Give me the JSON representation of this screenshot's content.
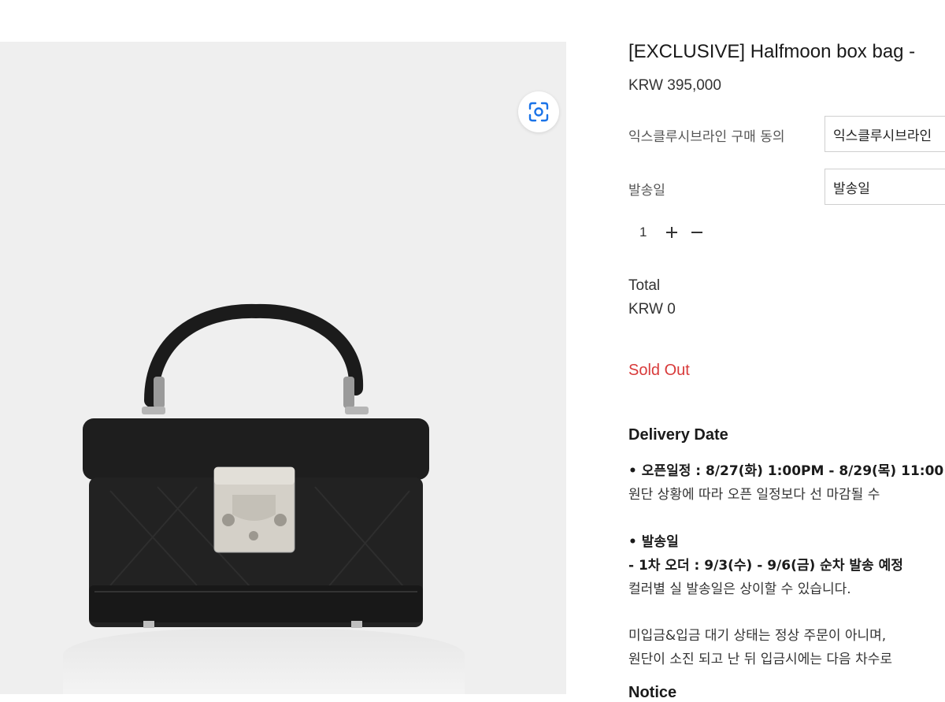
{
  "product": {
    "title": "[EXCLUSIVE] Halfmoon box bag - ",
    "price": "KRW 395,000"
  },
  "options": [
    {
      "label": "익스클루시브라인 구매 동의",
      "selected": "익스클루시브라인"
    },
    {
      "label": "발송일",
      "selected": "발송일"
    }
  ],
  "quantity": {
    "value": "1",
    "increase": "+",
    "decrease": "−"
  },
  "total": {
    "label": "Total",
    "value": "KRW 0"
  },
  "status": "Sold Out",
  "delivery": {
    "title": "Delivery Date",
    "lines": [
      "• 오픈일정 : 8/27(화) 1:00PM - 8/29(목) 11:00",
      "원단 상황에 따라 오픈 일정보다 선 마감될 수",
      "• 발송일",
      "- 1차 오더 : 9/3(수) - 9/6(금) 순차 발송 예정",
      "컬러별 실 발송일은 상이할 수 있습니다.",
      "미입금&입금 대기 상태는 정상 주문이 아니며,",
      "원단이 소진 되고 난 뒤 입금시에는 다음 차수로"
    ]
  },
  "notice": {
    "title": "Notice"
  },
  "icons": {
    "lens": "visual-search-icon"
  },
  "colors": {
    "sold_out": "#d83a3a",
    "lens_accent": "#1a73e8"
  }
}
